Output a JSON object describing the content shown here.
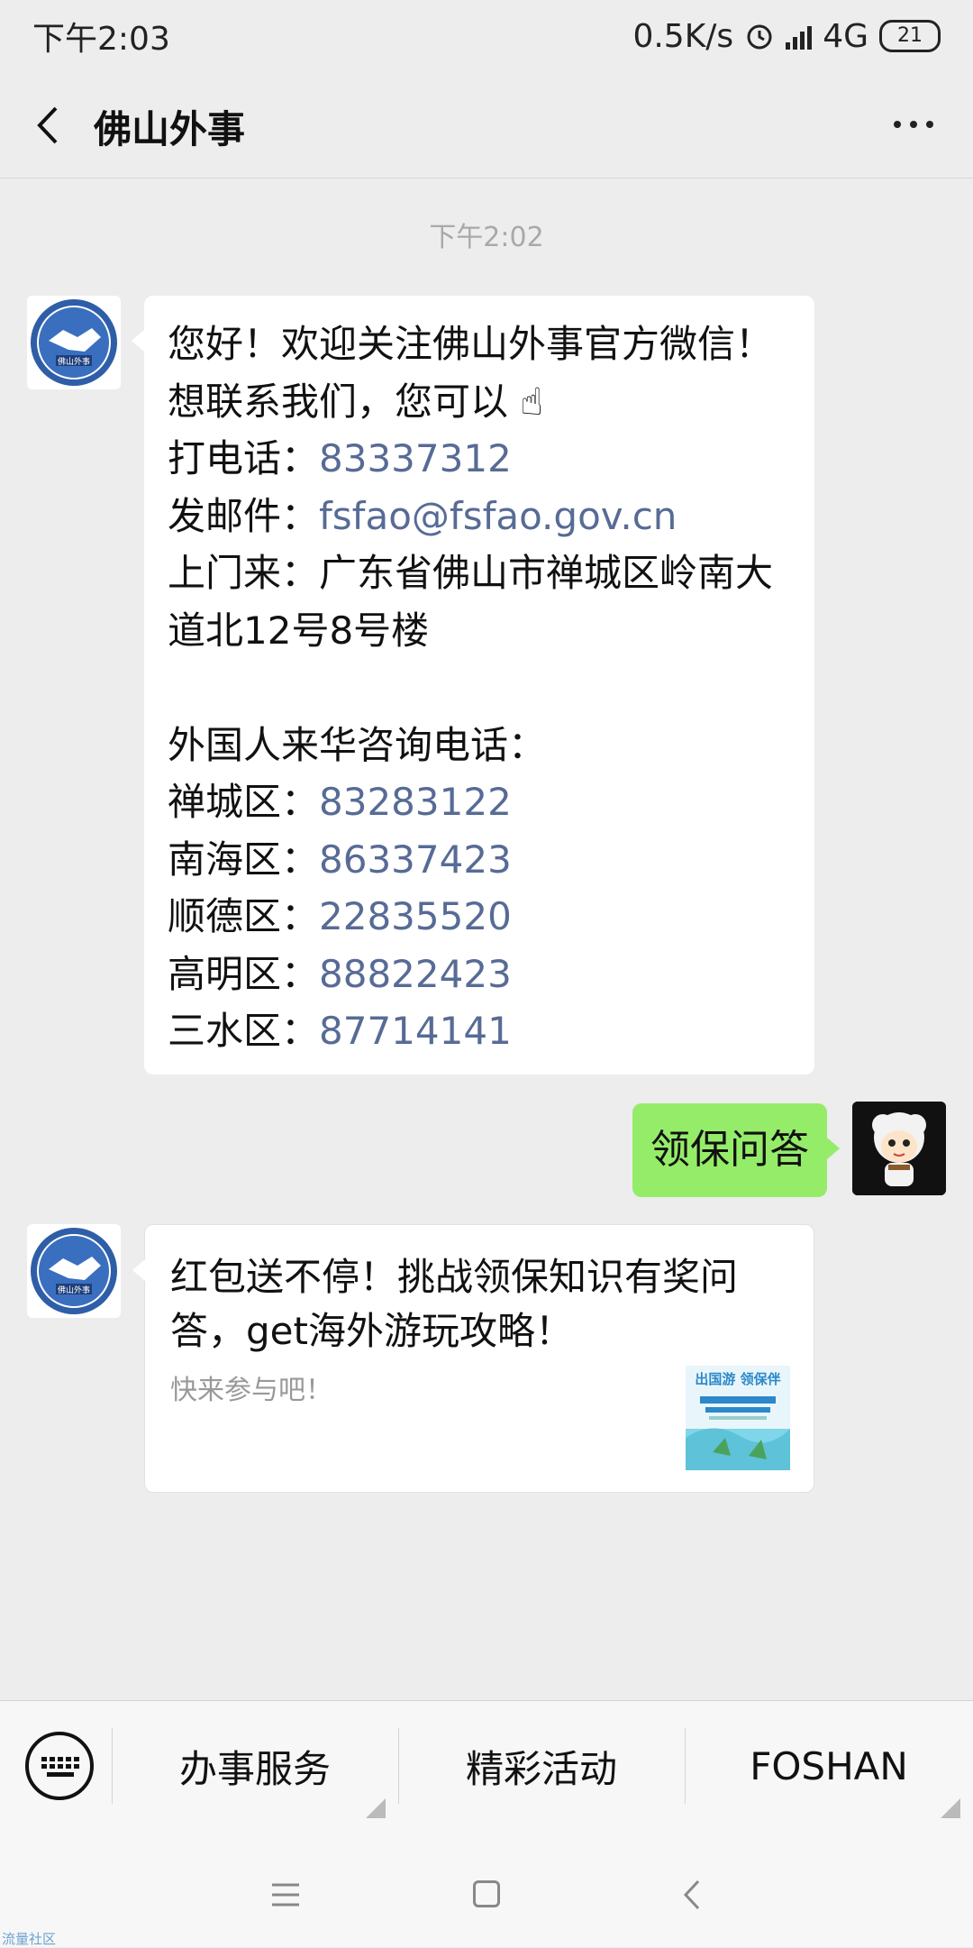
{
  "status_bar": {
    "time": "下午2:03",
    "net_speed": "0.5K/s",
    "network": "4G",
    "battery": "21"
  },
  "header": {
    "title": "佛山外事"
  },
  "chat": {
    "timestamp": "下午2:02",
    "welcome": {
      "line1": "您好！欢迎关注佛山外事官方微信！",
      "line2": "想联系我们，您可以",
      "phone_label": "打电话：",
      "phone": "83337312",
      "email_label": "发邮件：",
      "email": "fsfao@fsfao.gov.cn",
      "address_label": "上门来：",
      "address_part1": "广东省佛山市禅城区岭南大",
      "address_part2": "道北12号8号楼",
      "foreign_header": "外国人来华咨询电话：",
      "districts": [
        {
          "label": "禅城区：",
          "phone": "83283122"
        },
        {
          "label": "南海区：",
          "phone": "86337423"
        },
        {
          "label": "顺德区：",
          "phone": "22835520"
        },
        {
          "label": "高明区：",
          "phone": "88822423"
        },
        {
          "label": "三水区：",
          "phone": "87714141"
        }
      ]
    },
    "sent_message": "领保问答",
    "card": {
      "title": "红包送不停！挑战领保知识有奖问答，get海外游玩攻略！",
      "desc": "快来参与吧！",
      "thumb_text": "出国游 领保伴"
    },
    "avatar_label": "佛山外事"
  },
  "menu": {
    "items": [
      "办事服务",
      "精彩活动",
      "FOSHAN"
    ]
  },
  "watermark": "流量社区",
  "colors": {
    "link": "#576b95",
    "sent_bubble": "#95ec69",
    "background": "#ededed"
  }
}
